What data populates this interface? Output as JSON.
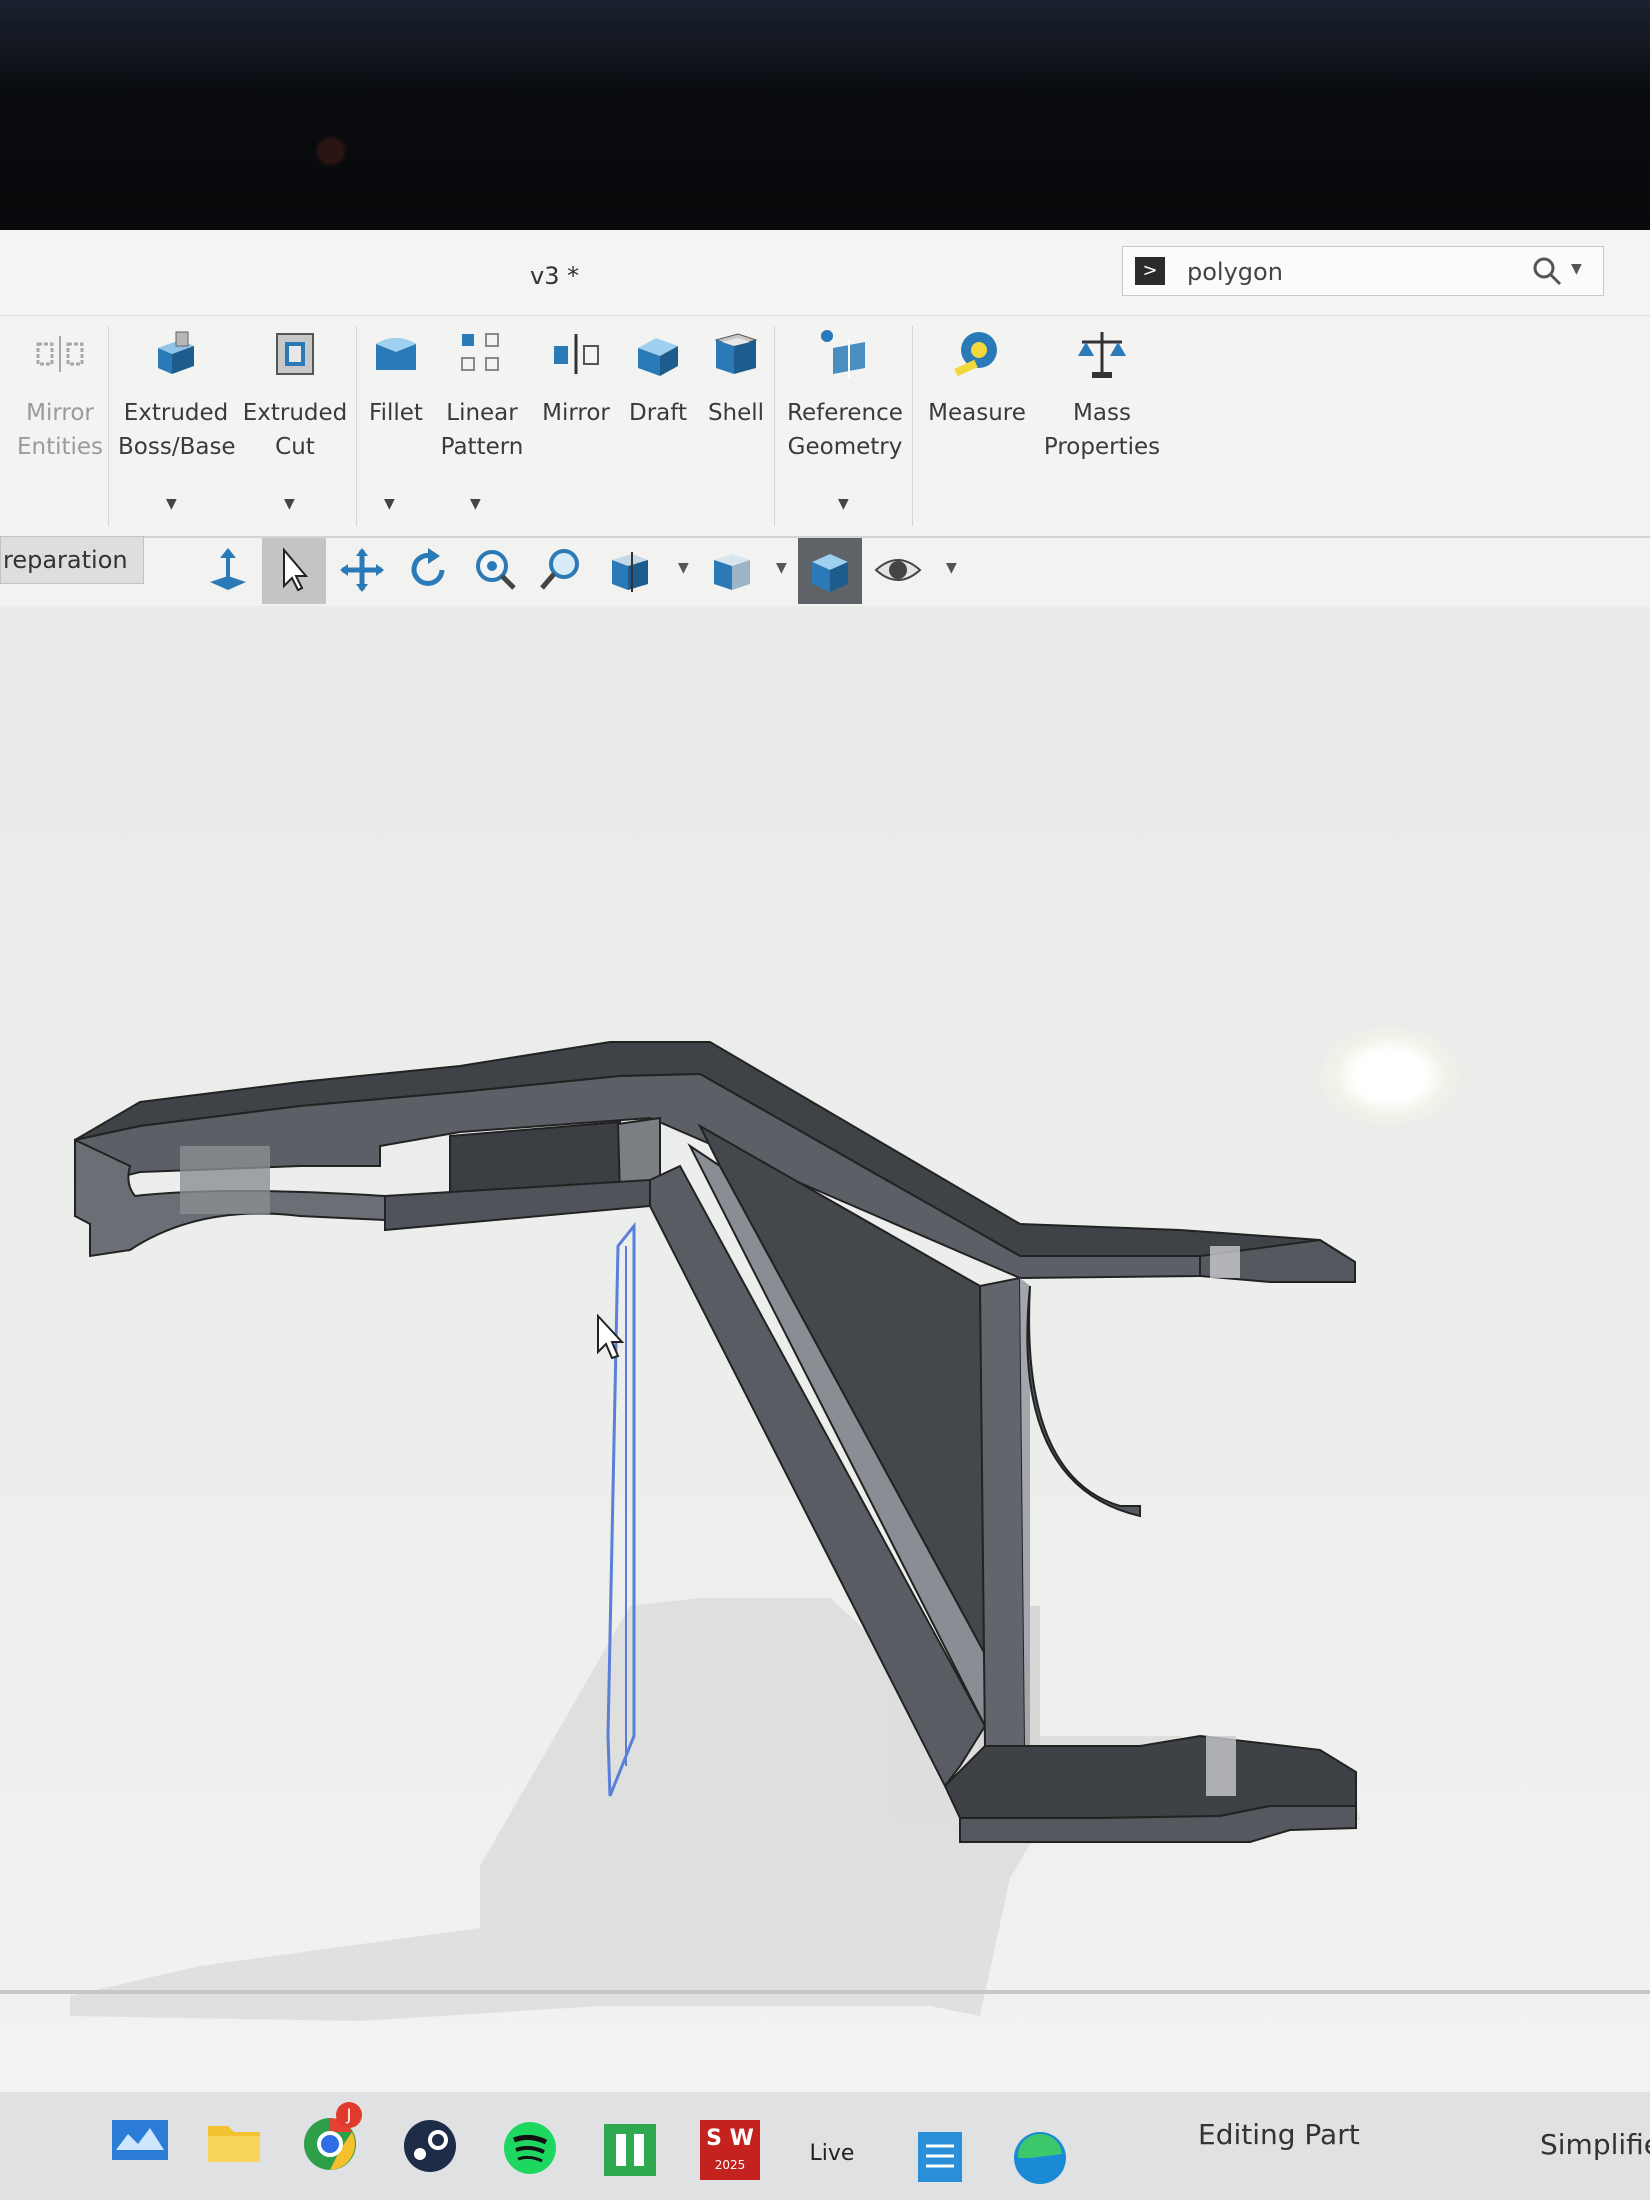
{
  "titlebar": {
    "doc_title": "v3 *",
    "search": {
      "value": "polygon",
      "placeholder": ""
    }
  },
  "ribbon": {
    "mirror_entities": "Mirror\nEntities",
    "extruded_boss": "Extruded\nBoss/Base",
    "extruded_cut": "Extruded\nCut",
    "fillet": "Fillet",
    "linear_pattern": "Linear\nPattern",
    "mirror": "Mirror",
    "draft": "Draft",
    "shell": "Shell",
    "reference_geometry": "Reference\nGeometry",
    "measure": "Measure",
    "mass_properties": "Mass\nProperties"
  },
  "tabs": {
    "preparation": "reparation"
  },
  "status": {
    "editing": "Editing Part",
    "simplify": "Simplifie"
  },
  "taskbar": {
    "chrome_badge": "J",
    "sw_label": "S W",
    "sw_year": "2025",
    "live_label": "Live"
  },
  "colors": {
    "part_dark": "#3f4247",
    "part_mid": "#5c6066",
    "part_light": "#8a8e94",
    "sketch_blue": "#5a7fd8",
    "accent_blue": "#2a7ab8"
  }
}
